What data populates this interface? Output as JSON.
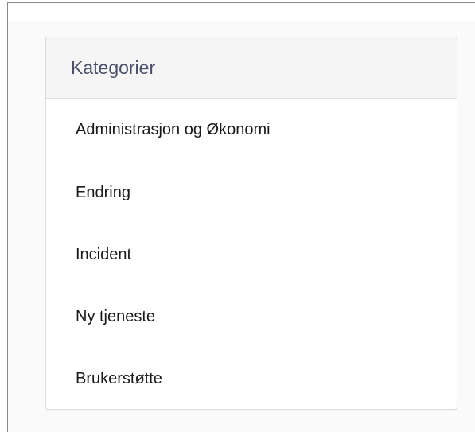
{
  "panel": {
    "title": "Kategorier",
    "items": [
      {
        "label": "Administrasjon og Økonomi"
      },
      {
        "label": "Endring"
      },
      {
        "label": "Incident"
      },
      {
        "label": "Ny tjeneste"
      },
      {
        "label": "Brukerstøtte"
      }
    ]
  }
}
